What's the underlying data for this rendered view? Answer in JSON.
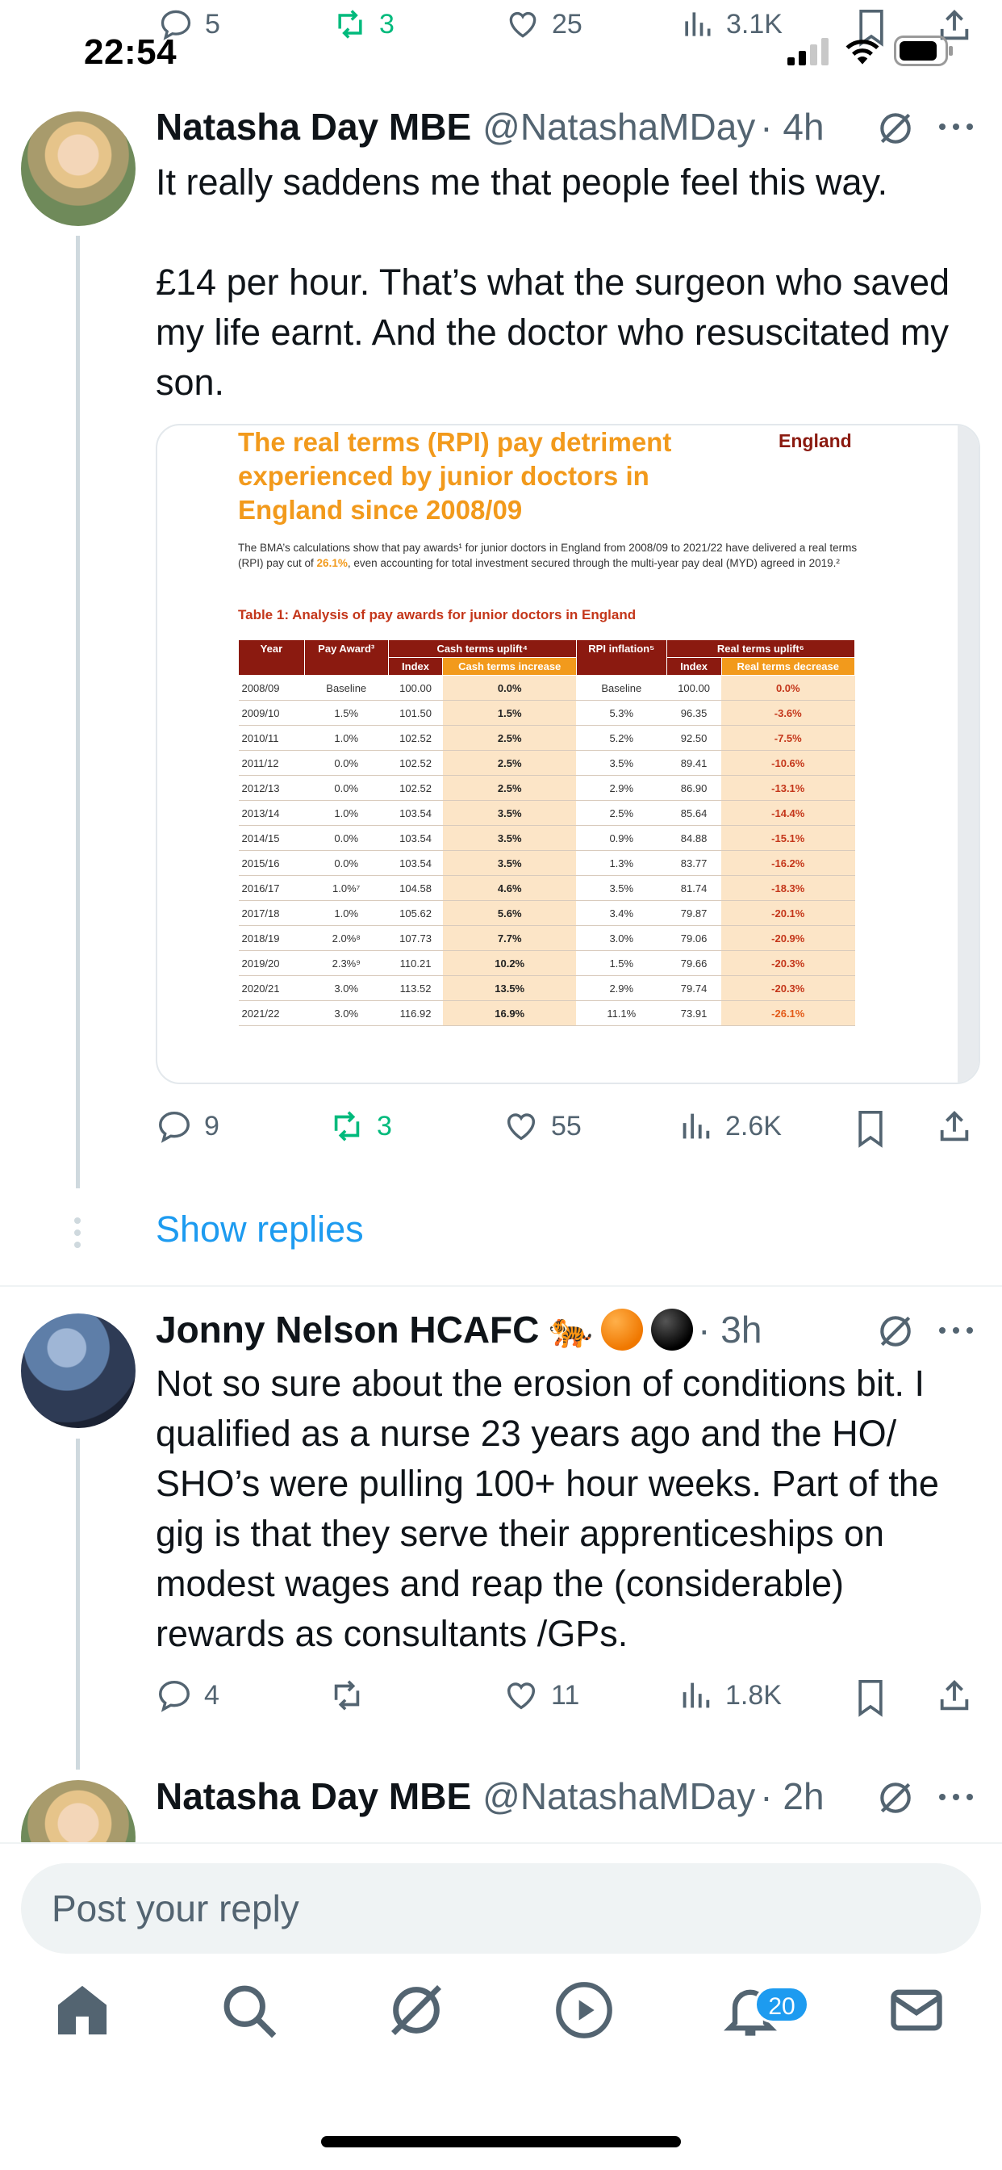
{
  "status_bar": {
    "time": "22:54"
  },
  "top_stats": {
    "replies": "5",
    "reposts": "3",
    "likes": "25",
    "views": "3.1K"
  },
  "tweet1": {
    "name": "Natasha Day MBE",
    "handle": "@NatashaMDay",
    "time": "· 4h",
    "text": "It really saddens me that people feel this way.\n\n£14 per hour. That’s what the surgeon who saved my life earnt. And the doctor who resuscitated my son.",
    "stats": {
      "replies": "9",
      "reposts": "3",
      "likes": "55",
      "views": "2.6K"
    }
  },
  "doc": {
    "title": "The real terms (RPI) pay detriment experienced by junior doctors in England since 2008/09",
    "tag": "England",
    "para_a": "The BMA’s calculations show that pay awards¹ for junior doctors in England from 2008/09 to 2021/22 have delivered a real terms (RPI) pay cut of ",
    "para_highlight": "26.1%",
    "para_b": ", even accounting for total investment secured through the multi-year pay deal (MYD) agreed in 2019.²",
    "caption": "Table 1: Analysis of pay awards for junior doctors in England",
    "headers": {
      "year": "Year",
      "pay_award": "Pay Award³",
      "cash_uplift": "Cash terms uplift⁴",
      "rpi": "RPI inflation⁵",
      "real_uplift": "Real terms uplift⁶",
      "index": "Index",
      "cash_increase": "Cash terms increase",
      "index2": "Index",
      "real_decrease": "Real terms decrease"
    },
    "rows": [
      [
        "2008/09",
        "Baseline",
        "100.00",
        "0.0%",
        "Baseline",
        "100.00",
        "0.0%"
      ],
      [
        "2009/10",
        "1.5%",
        "101.50",
        "1.5%",
        "5.3%",
        "96.35",
        "-3.6%"
      ],
      [
        "2010/11",
        "1.0%",
        "102.52",
        "2.5%",
        "5.2%",
        "92.50",
        "-7.5%"
      ],
      [
        "2011/12",
        "0.0%",
        "102.52",
        "2.5%",
        "3.5%",
        "89.41",
        "-10.6%"
      ],
      [
        "2012/13",
        "0.0%",
        "102.52",
        "2.5%",
        "2.9%",
        "86.90",
        "-13.1%"
      ],
      [
        "2013/14",
        "1.0%",
        "103.54",
        "3.5%",
        "2.5%",
        "85.64",
        "-14.4%"
      ],
      [
        "2014/15",
        "0.0%",
        "103.54",
        "3.5%",
        "0.9%",
        "84.88",
        "-15.1%"
      ],
      [
        "2015/16",
        "0.0%",
        "103.54",
        "3.5%",
        "1.3%",
        "83.77",
        "-16.2%"
      ],
      [
        "2016/17",
        "1.0%⁷",
        "104.58",
        "4.6%",
        "3.5%",
        "81.74",
        "-18.3%"
      ],
      [
        "2017/18",
        "1.0%",
        "105.62",
        "5.6%",
        "3.4%",
        "79.87",
        "-20.1%"
      ],
      [
        "2018/19",
        "2.0%⁸",
        "107.73",
        "7.7%",
        "3.0%",
        "79.06",
        "-20.9%"
      ],
      [
        "2019/20",
        "2.3%⁹",
        "110.21",
        "10.2%",
        "1.5%",
        "79.66",
        "-20.3%"
      ],
      [
        "2020/21",
        "3.0%",
        "113.52",
        "13.5%",
        "2.9%",
        "79.74",
        "-20.3%"
      ],
      [
        "2021/22",
        "3.0%",
        "116.92",
        "16.9%",
        "11.1%",
        "73.91",
        "-26.1%"
      ]
    ]
  },
  "show_replies": "Show replies",
  "tweet2": {
    "name": "Jonny Nelson HCAFC",
    "emoji": "🐅",
    "time": "· 3h",
    "text": "Not so sure about the erosion of conditions bit. I qualified as a nurse 23 years ago and the HO/ SHO’s were pulling 100+ hour weeks.  Part of the gig is that they serve their apprenticeships on modest wages and reap the (considerable) rewards as consultants /GPs.",
    "stats": {
      "replies": "4",
      "reposts": "",
      "likes": "11",
      "views": "1.8K"
    }
  },
  "tweet3": {
    "name": "Natasha Day MBE",
    "handle": "@NatashaMDay",
    "time": "· 2h"
  },
  "reply_box": {
    "placeholder": "Post your reply"
  },
  "tabbar": {
    "notifications_badge": "20"
  },
  "colors": {
    "accent": "#1d9bf0",
    "repost_green": "#00ba7c",
    "muted": "#536471"
  }
}
